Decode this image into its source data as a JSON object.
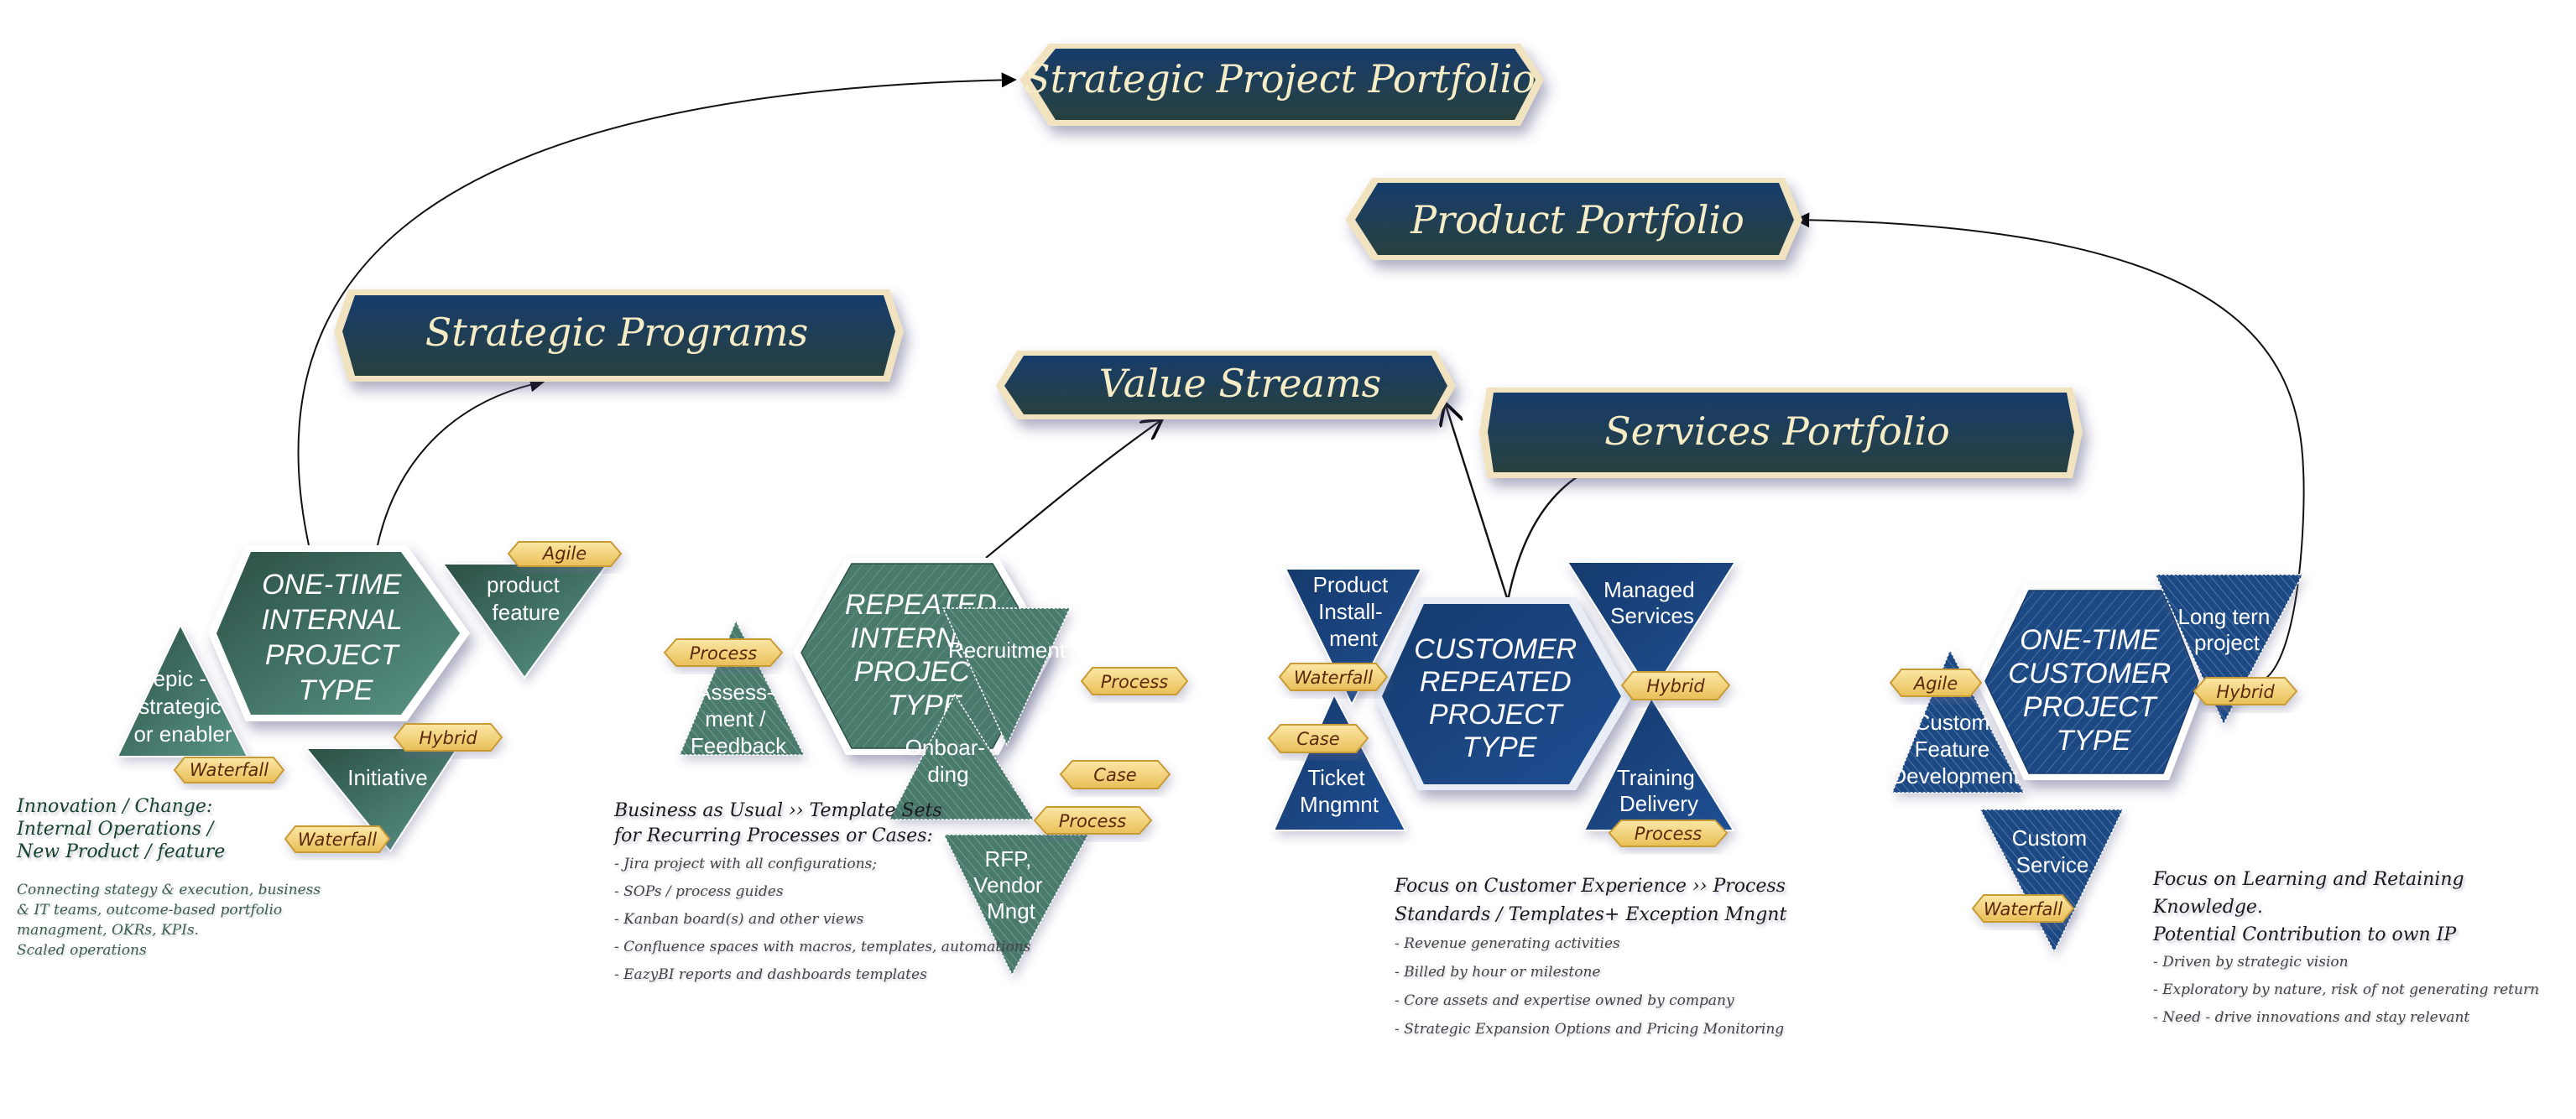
{
  "colors": {
    "banner_top": "#173d6b",
    "banner_bottom": "#28403f",
    "banner_border": "#f1e3bf",
    "banner_text": "#f6ecc5",
    "green_shape": "#4c7a6e",
    "green_shape_dark": "#2b4f45",
    "blue_shape": "#1a4a88",
    "blue_shape_dark": "#183a6c",
    "tag_fill": "#f5d47f",
    "tag_text": "#5a2a08"
  },
  "banners": {
    "strategic_project_portfolio": "Strategic Project Portfolio",
    "product_portfolio": "Product Portfolio",
    "strategic_programs": "Strategic Programs",
    "value_streams": "Value Streams",
    "services_portfolio": "Services Portfolio"
  },
  "clusters": {
    "one_time_internal": {
      "hexagon": [
        "ONE-TIME",
        "INTERNAL",
        "PROJECT",
        "TYPE"
      ],
      "triangles": {
        "epic": [
          "epic -",
          "strategic",
          "or enabler"
        ],
        "product_feature": [
          "product",
          "feature"
        ],
        "initiative": [
          "Initiative"
        ]
      },
      "tags": {
        "agile": "Agile",
        "hybrid": "Hybrid",
        "waterfall_epic": "Waterfall",
        "waterfall_initiative": "Waterfall"
      }
    },
    "repeated_internal": {
      "hexagon": [
        "REPEATED",
        "INTERNAL",
        "PROJECT",
        "TYPE"
      ],
      "triangles": {
        "assessment": [
          "Assess-",
          "ment /",
          "Feedback"
        ],
        "recruitment": [
          "Recruitment"
        ],
        "onboarding": [
          "Onboar-",
          "ding"
        ],
        "rfp": [
          "RFP,",
          "Vendor",
          "Mngt"
        ]
      },
      "tags": {
        "process_assessment": "Process",
        "process_recruitment": "Process",
        "case_onboarding": "Case",
        "process_onboarding": "Process"
      }
    },
    "customer_repeated": {
      "hexagon": [
        "CUSTOMER",
        "REPEATED",
        "PROJECT",
        "TYPE"
      ],
      "triangles": {
        "product_installment": [
          "Product",
          "Install-",
          "ment"
        ],
        "ticket": [
          "Ticket",
          "Mngmnt"
        ],
        "managed_services": [
          "Managed",
          "Services"
        ],
        "training": [
          "Training",
          "Delivery"
        ]
      },
      "tags": {
        "waterfall": "Waterfall",
        "case": "Case",
        "hybrid": "Hybrid",
        "process": "Process"
      }
    },
    "one_time_customer": {
      "hexagon": [
        "ONE-TIME",
        "CUSTOMER",
        "PROJECT",
        "TYPE"
      ],
      "triangles": {
        "long_term": [
          "Long tern",
          "project"
        ],
        "custom_feature": [
          "Custom",
          "Feature",
          "Development"
        ],
        "custom_service": [
          "Custom",
          "Service"
        ]
      },
      "tags": {
        "agile": "Agile",
        "hybrid": "Hybrid",
        "waterfall": "Waterfall"
      }
    }
  },
  "notes": {
    "innovation": {
      "heading": [
        "Innovation / Change:",
        "Internal Operations /",
        "New Product / feature"
      ],
      "items": [
        "Connecting stategy & execution, business",
        "& IT teams, outcome-based portfolio",
        "managment, OKRs, KPIs.",
        "Scaled operations"
      ]
    },
    "business_as_usual": {
      "heading": [
        "Business as Usual ›› Template Sets",
        "for Recurring Processes or Cases:"
      ],
      "items": [
        "- Jira project with all configurations;",
        "- SOPs / process guides",
        "- Kanban board(s) and other views",
        "- Confluence spaces with macros, templates, automations",
        "- EazyBI reports and dashboards templates"
      ]
    },
    "customer_experience": {
      "heading": [
        "Focus on Customer Experience ›› Process",
        "Standards / Templates+ Exception Mngnt"
      ],
      "items": [
        "- Revenue generating activities",
        "- Billed by hour or milestone",
        "- Core assets and expertise owned by company",
        "- Strategic Expansion Options and Pricing Monitoring"
      ]
    },
    "learning": {
      "heading": [
        "Focus on Learning and Retaining Knowledge.",
        "Potential Contribution to own IP"
      ],
      "items": [
        "- Driven by strategic vision",
        "- Exploratory by nature, risk of not generating return",
        "- Need - drive innovations and stay relevant"
      ]
    }
  }
}
